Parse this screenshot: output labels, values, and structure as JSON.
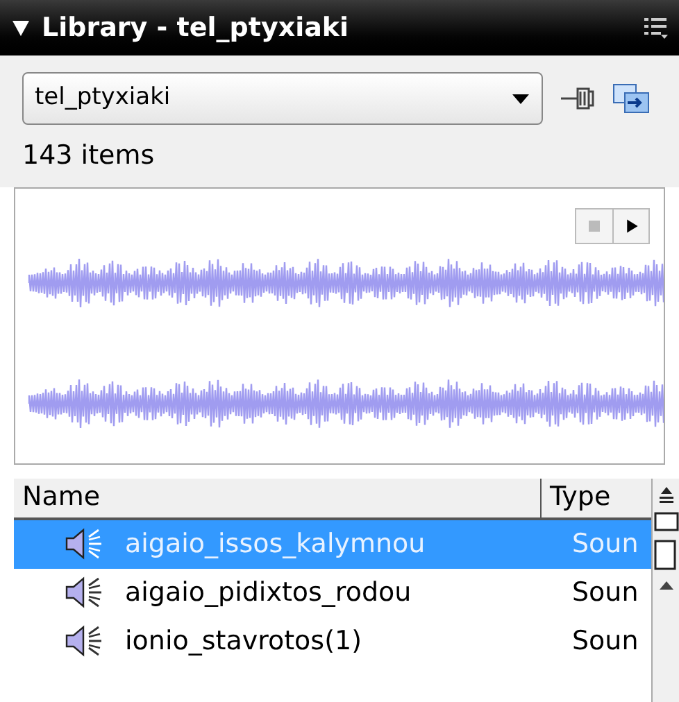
{
  "panel": {
    "title": "Library - tel_ptyxiaki",
    "expanded": true
  },
  "library_select": {
    "value": "tel_ptyxiaki"
  },
  "item_count": "143 items",
  "table": {
    "columns": [
      "Name",
      "Type"
    ],
    "rows": [
      {
        "name": "aigaio_issos_kalymnou",
        "type": "Soun",
        "selected": true
      },
      {
        "name": "aigaio_pidixtos_rodou",
        "type": "Soun",
        "selected": false
      },
      {
        "name": "ionio_stavrotos(1)",
        "type": "Soun",
        "selected": false
      }
    ]
  }
}
